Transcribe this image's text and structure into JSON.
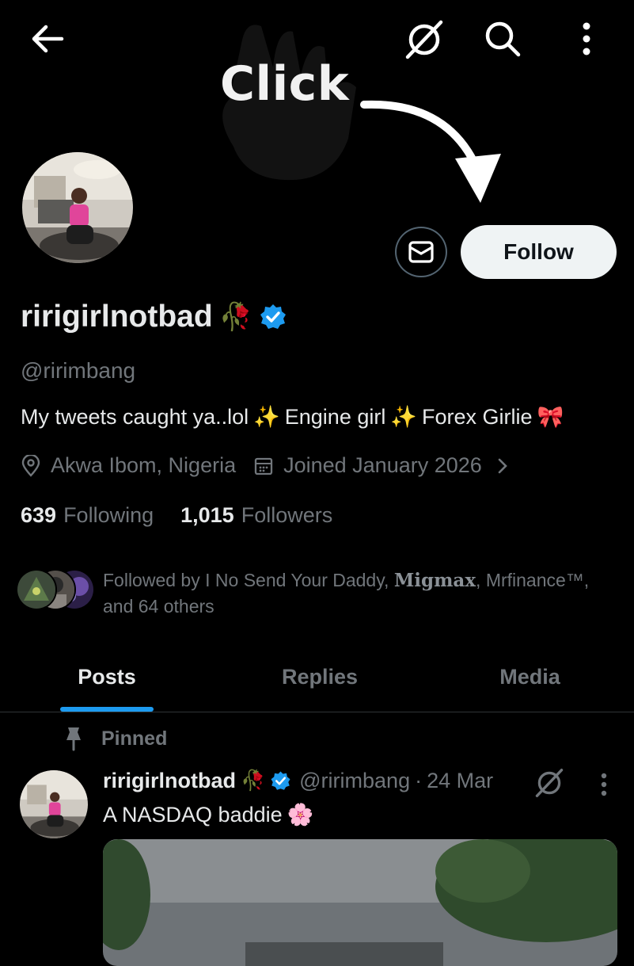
{
  "header": {
    "back_icon": "arrow-left-icon",
    "grok_icon": "grok-slash-circle-icon",
    "search_icon": "search-icon",
    "more_icon": "more-vertical-icon"
  },
  "overlay": {
    "click_text": "Click"
  },
  "profile": {
    "display_name": "ririgirlnotbad",
    "name_emoji": "🥀",
    "verified": true,
    "handle": "@ririmbang",
    "bio_parts": [
      "My tweets caught ya..lol",
      "✨",
      " Engine girl",
      "✨",
      " Forex Girlie ",
      "🎀"
    ],
    "location": "Akwa Ibom, Nigeria",
    "joined": "Joined January 2026",
    "following_count": "639",
    "following_label": "Following",
    "followers_count": "1,015",
    "followers_label": "Followers"
  },
  "actions": {
    "message_icon": "mail-icon",
    "follow_label": "Follow"
  },
  "followed_by": {
    "prefix": "Followed by I No Send Your Daddy, ",
    "name2": "Migmax",
    "suffix": ", Mrfinance™,",
    "line2": "and 64 others"
  },
  "tabs": [
    {
      "label": "Posts",
      "active": true
    },
    {
      "label": "Replies",
      "active": false
    },
    {
      "label": "Media",
      "active": false
    }
  ],
  "pinned_label": "Pinned",
  "post": {
    "name": "ririgirlnotbad",
    "emoji": "🥀",
    "handle": "@ririmbang",
    "separator": "·",
    "date": "24 Mar",
    "text": "A NASDAQ baddie",
    "text_emoji": "🌸"
  },
  "colors": {
    "background": "#000000",
    "text_primary": "#e7e9ea",
    "text_secondary": "#71767b",
    "accent": "#1d9bf0",
    "follow_button": "#eff3f4"
  }
}
